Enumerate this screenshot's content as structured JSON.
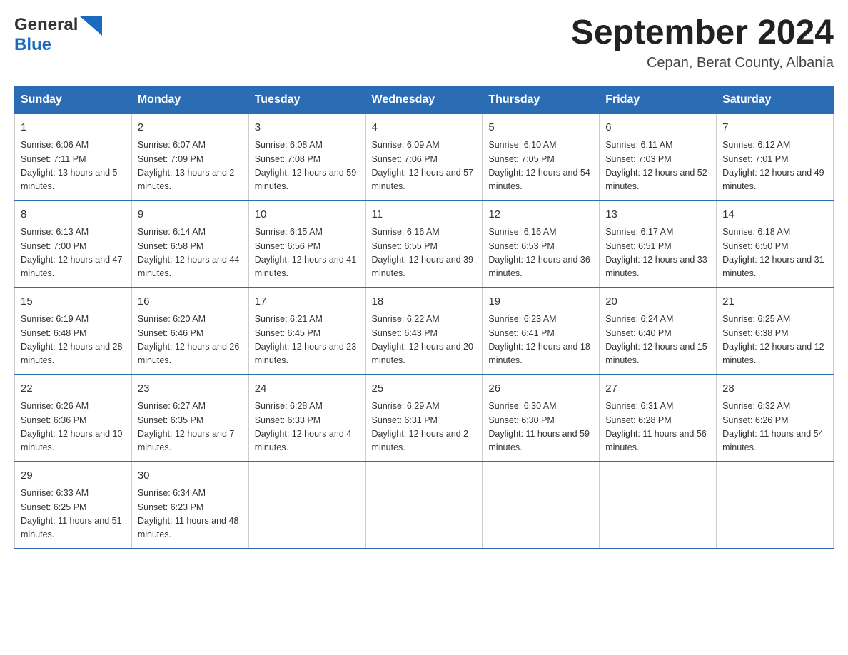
{
  "header": {
    "logo": {
      "text_general": "General",
      "text_blue": "Blue",
      "logo_label": "GeneralBlue logo"
    },
    "title": "September 2024",
    "subtitle": "Cepan, Berat County, Albania"
  },
  "days_of_week": [
    "Sunday",
    "Monday",
    "Tuesday",
    "Wednesday",
    "Thursday",
    "Friday",
    "Saturday"
  ],
  "weeks": [
    [
      {
        "day": "1",
        "sunrise": "6:06 AM",
        "sunset": "7:11 PM",
        "daylight": "13 hours and 5 minutes."
      },
      {
        "day": "2",
        "sunrise": "6:07 AM",
        "sunset": "7:09 PM",
        "daylight": "13 hours and 2 minutes."
      },
      {
        "day": "3",
        "sunrise": "6:08 AM",
        "sunset": "7:08 PM",
        "daylight": "12 hours and 59 minutes."
      },
      {
        "day": "4",
        "sunrise": "6:09 AM",
        "sunset": "7:06 PM",
        "daylight": "12 hours and 57 minutes."
      },
      {
        "day": "5",
        "sunrise": "6:10 AM",
        "sunset": "7:05 PM",
        "daylight": "12 hours and 54 minutes."
      },
      {
        "day": "6",
        "sunrise": "6:11 AM",
        "sunset": "7:03 PM",
        "daylight": "12 hours and 52 minutes."
      },
      {
        "day": "7",
        "sunrise": "6:12 AM",
        "sunset": "7:01 PM",
        "daylight": "12 hours and 49 minutes."
      }
    ],
    [
      {
        "day": "8",
        "sunrise": "6:13 AM",
        "sunset": "7:00 PM",
        "daylight": "12 hours and 47 minutes."
      },
      {
        "day": "9",
        "sunrise": "6:14 AM",
        "sunset": "6:58 PM",
        "daylight": "12 hours and 44 minutes."
      },
      {
        "day": "10",
        "sunrise": "6:15 AM",
        "sunset": "6:56 PM",
        "daylight": "12 hours and 41 minutes."
      },
      {
        "day": "11",
        "sunrise": "6:16 AM",
        "sunset": "6:55 PM",
        "daylight": "12 hours and 39 minutes."
      },
      {
        "day": "12",
        "sunrise": "6:16 AM",
        "sunset": "6:53 PM",
        "daylight": "12 hours and 36 minutes."
      },
      {
        "day": "13",
        "sunrise": "6:17 AM",
        "sunset": "6:51 PM",
        "daylight": "12 hours and 33 minutes."
      },
      {
        "day": "14",
        "sunrise": "6:18 AM",
        "sunset": "6:50 PM",
        "daylight": "12 hours and 31 minutes."
      }
    ],
    [
      {
        "day": "15",
        "sunrise": "6:19 AM",
        "sunset": "6:48 PM",
        "daylight": "12 hours and 28 minutes."
      },
      {
        "day": "16",
        "sunrise": "6:20 AM",
        "sunset": "6:46 PM",
        "daylight": "12 hours and 26 minutes."
      },
      {
        "day": "17",
        "sunrise": "6:21 AM",
        "sunset": "6:45 PM",
        "daylight": "12 hours and 23 minutes."
      },
      {
        "day": "18",
        "sunrise": "6:22 AM",
        "sunset": "6:43 PM",
        "daylight": "12 hours and 20 minutes."
      },
      {
        "day": "19",
        "sunrise": "6:23 AM",
        "sunset": "6:41 PM",
        "daylight": "12 hours and 18 minutes."
      },
      {
        "day": "20",
        "sunrise": "6:24 AM",
        "sunset": "6:40 PM",
        "daylight": "12 hours and 15 minutes."
      },
      {
        "day": "21",
        "sunrise": "6:25 AM",
        "sunset": "6:38 PM",
        "daylight": "12 hours and 12 minutes."
      }
    ],
    [
      {
        "day": "22",
        "sunrise": "6:26 AM",
        "sunset": "6:36 PM",
        "daylight": "12 hours and 10 minutes."
      },
      {
        "day": "23",
        "sunrise": "6:27 AM",
        "sunset": "6:35 PM",
        "daylight": "12 hours and 7 minutes."
      },
      {
        "day": "24",
        "sunrise": "6:28 AM",
        "sunset": "6:33 PM",
        "daylight": "12 hours and 4 minutes."
      },
      {
        "day": "25",
        "sunrise": "6:29 AM",
        "sunset": "6:31 PM",
        "daylight": "12 hours and 2 minutes."
      },
      {
        "day": "26",
        "sunrise": "6:30 AM",
        "sunset": "6:30 PM",
        "daylight": "11 hours and 59 minutes."
      },
      {
        "day": "27",
        "sunrise": "6:31 AM",
        "sunset": "6:28 PM",
        "daylight": "11 hours and 56 minutes."
      },
      {
        "day": "28",
        "sunrise": "6:32 AM",
        "sunset": "6:26 PM",
        "daylight": "11 hours and 54 minutes."
      }
    ],
    [
      {
        "day": "29",
        "sunrise": "6:33 AM",
        "sunset": "6:25 PM",
        "daylight": "11 hours and 51 minutes."
      },
      {
        "day": "30",
        "sunrise": "6:34 AM",
        "sunset": "6:23 PM",
        "daylight": "11 hours and 48 minutes."
      },
      null,
      null,
      null,
      null,
      null
    ]
  ],
  "labels": {
    "sunrise_prefix": "Sunrise: ",
    "sunset_prefix": "Sunset: ",
    "daylight_prefix": "Daylight: "
  }
}
